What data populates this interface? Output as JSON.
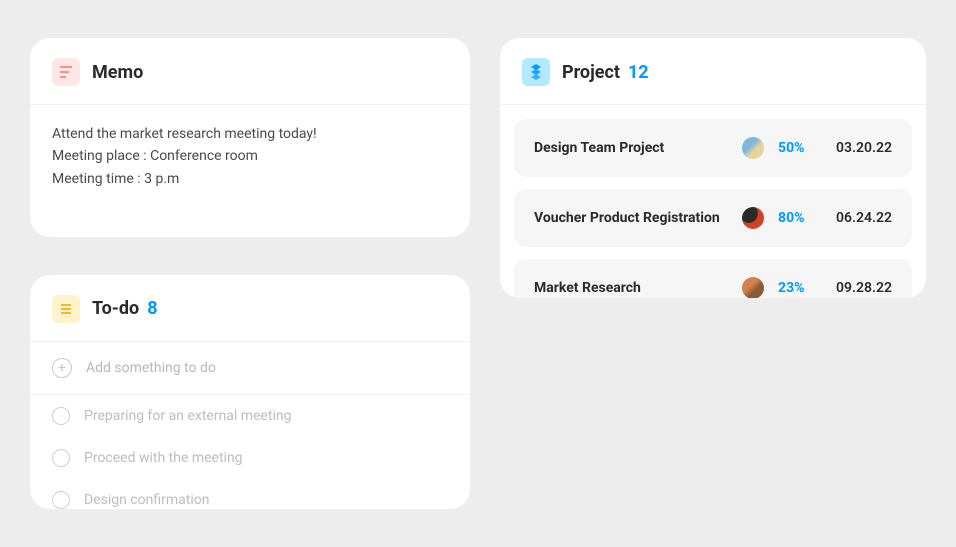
{
  "memo": {
    "title": "Memo",
    "lines": [
      "Attend the market research meeting today!",
      "Meeting place : Conference room",
      "Meeting time : 3 p.m"
    ]
  },
  "todo": {
    "title": "To-do",
    "count": "8",
    "add_placeholder": "Add something to do",
    "items": [
      "Preparing for an external meeting",
      "Proceed with the meeting",
      "Design confirmation"
    ]
  },
  "project": {
    "title": "Project",
    "count": "12",
    "rows": [
      {
        "name": "Design Team Project",
        "progress": "50%",
        "date": "03.20.22"
      },
      {
        "name": "Voucher Product Registration",
        "progress": "80%",
        "date": "06.24.22"
      },
      {
        "name": "Market Research",
        "progress": "23%",
        "date": "09.28.22"
      }
    ]
  }
}
